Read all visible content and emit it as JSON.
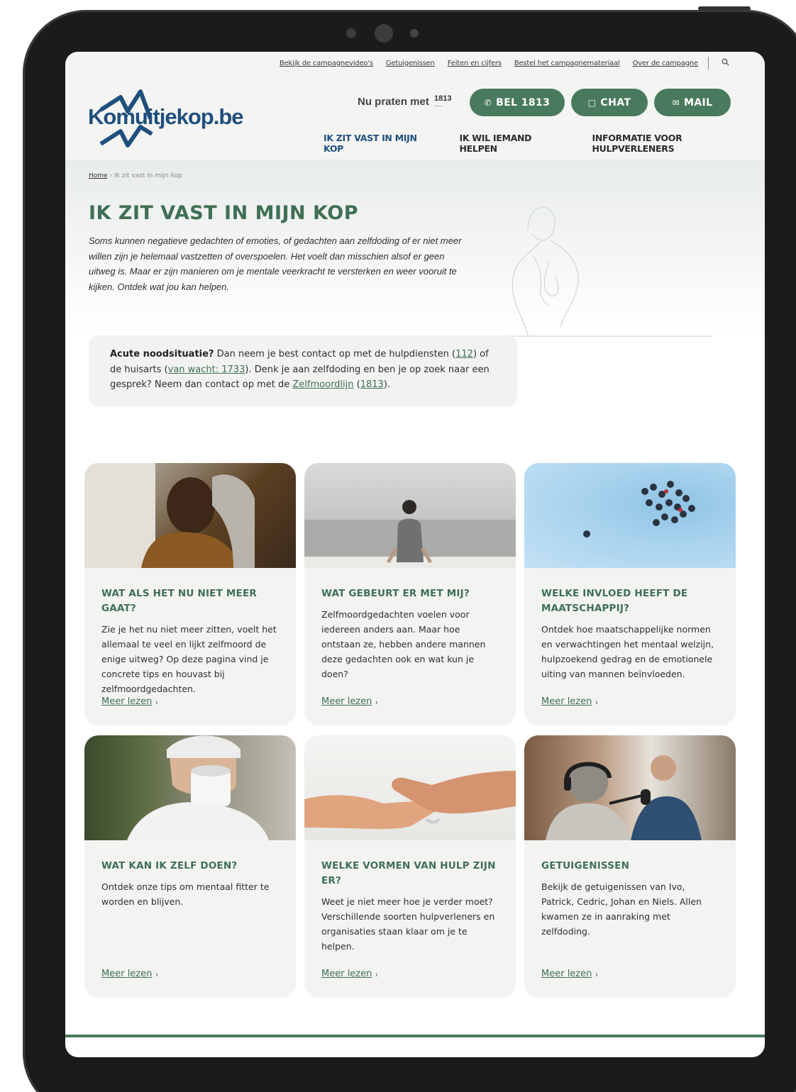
{
  "utility": {
    "links": [
      "Bekijk de campagnevideo's",
      "Getuigenissen",
      "Feiten en cijfers",
      "Bestel het campagnemateriaal",
      "Over de campagne"
    ],
    "search_icon": "search-icon"
  },
  "header": {
    "logo_text": "Komuitjekop.be",
    "nu_praten": "Nu praten met",
    "partner_logo": "1813",
    "buttons": {
      "call": "BEL 1813",
      "chat": "CHAT",
      "mail": "MAIL"
    },
    "nav": [
      "IK ZIT VAST IN MIJN KOP",
      "IK WIL IEMAND HELPEN",
      "INFORMATIE VOOR HULPVERLENERS"
    ]
  },
  "breadcrumb": {
    "home": "Home",
    "current": "Ik zit vast in mijn kop"
  },
  "page": {
    "title": "Ik zit vast in mijn kop",
    "intro": "Soms kunnen negatieve gedachten of emoties, of gedachten aan zelfdoding of er niet meer willen zijn je helemaal vastzetten of overspoelen. Het voelt dan misschien alsof er geen uitweg is. Maar er zijn manieren om je mentale veerkracht te versterken en weer vooruit te kijken. Ontdek wat jou kan helpen."
  },
  "alert": {
    "bold": "Acute noodsituatie?",
    "t1": " Dan neem je best contact op met de hulpdiensten (",
    "l1": "112",
    "t2": ") of de huisarts (",
    "l2": "van wacht: 1733",
    "t3": "). Denk je aan zelfdoding en ben je op zoek naar een gesprek? Neem dan contact op met de ",
    "l3": "Zelfmoordlijn",
    "t4": " (",
    "l4": "1813",
    "t5": ")."
  },
  "cards": [
    {
      "title": "Wat als het nu niet meer gaat?",
      "text": "Zie je het nu niet meer zitten, voelt het allemaal te veel en lijkt zelfmoord de enige uitweg? Op deze pagina vind je concrete tips en houvast bij zelfmoordgedachten.",
      "link": "Meer lezen"
    },
    {
      "title": "Wat gebeurt er met mij?",
      "text": "Zelfmoordgedachten voelen voor iedereen anders aan. Maar hoe ontstaan ze, hebben andere mannen deze gedachten ook en wat kun je doen?",
      "link": "Meer lezen"
    },
    {
      "title": "Welke invloed heeft de maatschappij?",
      "text": "Ontdek hoe maatschappelijke normen en verwachtingen het mentaal welzijn, hulpzoekend gedrag en de emotionele uiting van mannen beïnvloeden.",
      "link": "Meer lezen"
    },
    {
      "title": "Wat kan ik zelf doen?",
      "text": "Ontdek onze tips om mentaal fitter te worden en blijven.",
      "link": "Meer lezen"
    },
    {
      "title": "Welke vormen van hulp zijn er?",
      "text": "Weet je niet meer hoe je verder moet? Verschillende soorten hulpverleners en organisaties staan klaar om je te helpen.",
      "link": "Meer lezen"
    },
    {
      "title": "Getuigenissen",
      "text": "Bekijk de getuigenissen van Ivo, Patrick, Cedric, Johan en Niels. Allen kwamen ze in aanraking met zelfdoding.",
      "link": "Meer lezen"
    }
  ],
  "colors": {
    "brand_green": "#4a7a5e",
    "title_green": "#3f6f54",
    "logo_blue": "#1f4f7d"
  }
}
